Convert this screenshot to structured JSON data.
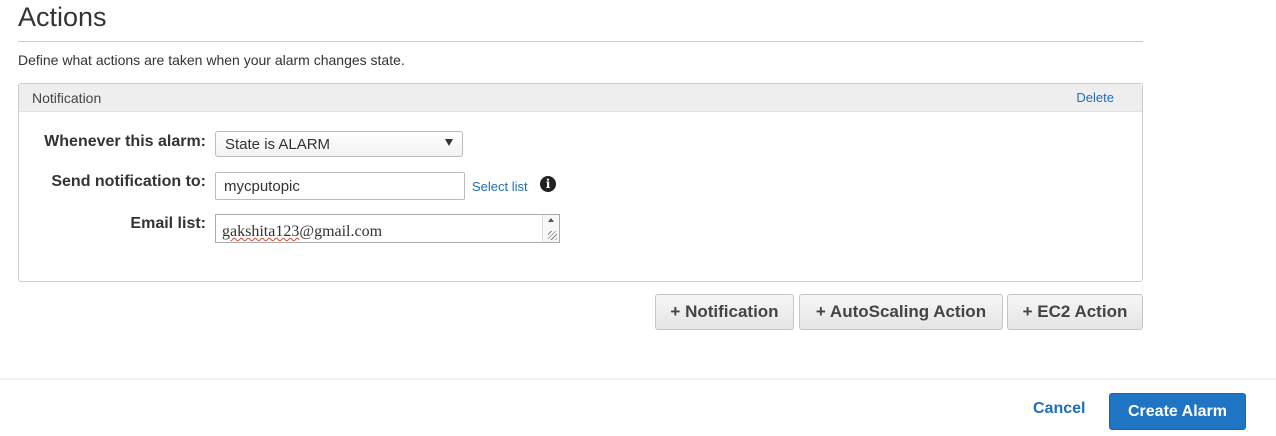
{
  "section": {
    "title": "Actions",
    "description": "Define what actions are taken when your alarm changes state."
  },
  "notification_panel": {
    "title": "Notification",
    "delete_label": "Delete",
    "fields": {
      "alarm_state_label": "Whenever this alarm:",
      "alarm_state_value": "State is ALARM",
      "send_to_label": "Send notification to:",
      "send_to_value": "mycputopic",
      "select_list_label": "Select list",
      "email_label": "Email list:",
      "email_value_user": "gakshita123",
      "email_value_domain": "@gmail.com"
    }
  },
  "action_buttons": {
    "notification": "+ Notification",
    "autoscaling": "+ AutoScaling Action",
    "ec2": "+ EC2 Action"
  },
  "footer": {
    "cancel_label": "Cancel",
    "create_label": "Create Alarm"
  },
  "icons": {
    "info": "info-icon"
  },
  "colors": {
    "link": "#1e6fb8",
    "primary_button": "#1f74c4"
  }
}
